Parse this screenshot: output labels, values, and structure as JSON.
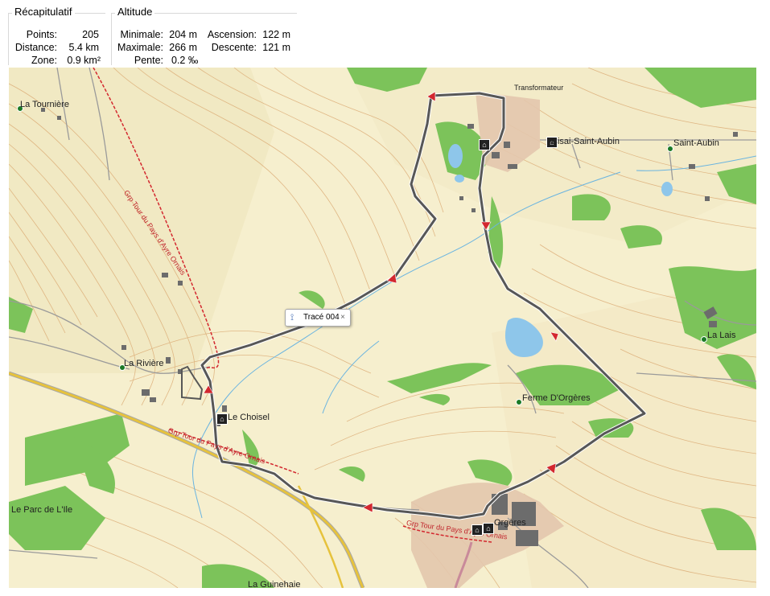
{
  "summary": {
    "title": "Récapitulatif",
    "rows": [
      {
        "label": "Points:",
        "value": "205"
      },
      {
        "label": "Distance:",
        "value": "5.4 km"
      },
      {
        "label": "Zone:",
        "value": "0.9 km²"
      }
    ]
  },
  "altitude": {
    "title": "Altitude",
    "minimale_label": "Minimale:",
    "minimale_value": "204 m",
    "ascension_label": "Ascension:",
    "ascension_value": "122 m",
    "maximale_label": "Maximale:",
    "maximale_value": "266 m",
    "descente_label": "Descente:",
    "descente_value": "121 m",
    "pente_label": "Pente:",
    "pente_value": "0.2 ‰"
  },
  "map": {
    "track_label": "Tracé 004",
    "close_glyph": "×",
    "places": {
      "la_tourniere": "La Tournière",
      "la_riviere": "La Rivière",
      "le_choisel": "Le Choisel",
      "le_parc": "Le Parc de L'Ile",
      "la_guinehaie": "La Guinehaie",
      "cisai": "Cisai-Saint-Aubin",
      "saint_aubin": "Saint-Aubin",
      "transformateur": "Transformateur",
      "la_lais": "La Lais",
      "ferme": "Ferme D'Orgères",
      "orgeres": "Orgères"
    },
    "trails": {
      "grp_north": "Grp Tour du Pays d'Ayre Ornais",
      "grp_south": "Grp Tour du Pays d'Ayre Ornais",
      "grp_east": "Grp Tour du Pays d'Ayre Ornais"
    },
    "icons": [
      "waypoint-dot",
      "church-icon",
      "track-direction-arrow",
      "track-icon"
    ],
    "colors": {
      "background": "#f6efce",
      "forest": "#7cc35a",
      "track": "#575757",
      "arrows": "#d3282f",
      "water": "#8ec6ea",
      "contour": "#d9a56d",
      "trail": "#d3282f",
      "road_major": "#e6c23c",
      "urban": "#e3c7ad"
    }
  }
}
